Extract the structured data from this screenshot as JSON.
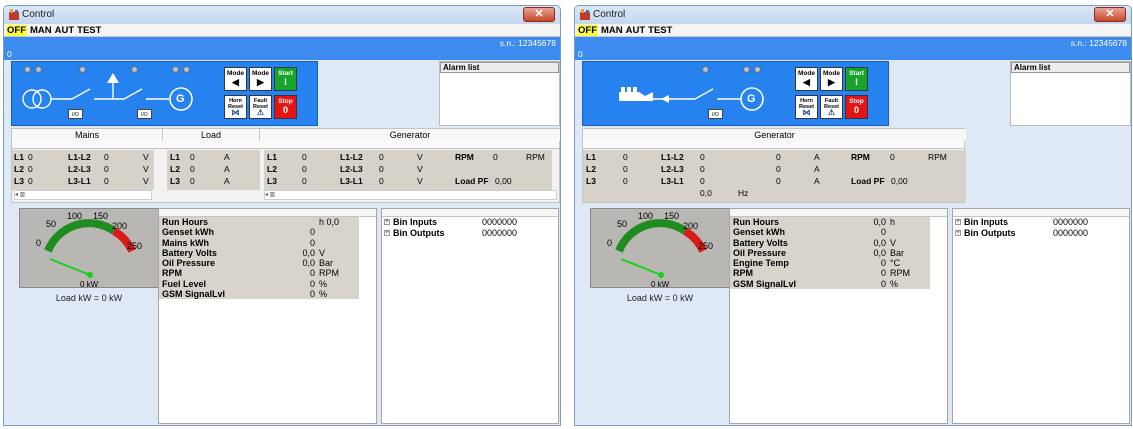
{
  "windows": [
    {
      "title": "Control",
      "close_glyph": "✕",
      "mode_bar": {
        "active": "OFF",
        "others": [
          "MAN",
          "AUT",
          "TEST"
        ]
      },
      "serial": "s.n.: 12345678",
      "bar_value": "0",
      "io_labels": [
        "I/O",
        "I/O"
      ],
      "gen_symbol": "G",
      "buttons": {
        "mode_left": {
          "label": "Mode",
          "glyph": "◀"
        },
        "mode_right": {
          "label": "Mode",
          "glyph": "▶"
        },
        "start": {
          "label": "Start",
          "glyph": "I"
        },
        "horn": {
          "label": "Horn Reset"
        },
        "fault": {
          "label": "Fault Reset"
        },
        "stop": {
          "label": "Stop",
          "glyph": "0"
        }
      },
      "alarm_list_header": "Alarm list",
      "sections": [
        "Mains",
        "Load",
        "Generator"
      ],
      "mains_rows": [
        [
          "L1",
          "0",
          "L1-L2",
          "0",
          "V"
        ],
        [
          "L2",
          "0",
          "L2-L3",
          "0",
          "V"
        ],
        [
          "L3",
          "0",
          "L3-L1",
          "0",
          "V"
        ]
      ],
      "load_rows": [
        [
          "L1",
          "0",
          "A"
        ],
        [
          "L2",
          "0",
          "A"
        ],
        [
          "L3",
          "0",
          "A"
        ]
      ],
      "gen_rows": [
        [
          "L1",
          "0",
          "L1-L2",
          "0",
          "V"
        ],
        [
          "L2",
          "0",
          "L2-L3",
          "0",
          "V"
        ],
        [
          "L3",
          "0",
          "L3-L1",
          "0",
          "V"
        ]
      ],
      "gen_extra": {
        "rpm_label": "RPM",
        "rpm_value": "0",
        "rpm_unit": "RPM",
        "loadpf_label": "Load PF",
        "loadpf_value": "0,00"
      },
      "gauge": {
        "ticks": [
          "0",
          "50",
          "100",
          "150",
          "200",
          "250"
        ],
        "readout": "0 kW",
        "caption": "Load kW = 0 kW",
        "value_fraction": 0
      },
      "values": [
        {
          "label": "Run Hours",
          "value": "0,0",
          "unit": "h"
        },
        {
          "label": "Genset kWh",
          "value": "0",
          "unit": ""
        },
        {
          "label": "Mains kWh",
          "value": "0",
          "unit": ""
        },
        {
          "label": "Battery Volts",
          "value": "0,0",
          "unit": "V"
        },
        {
          "label": "Oil Pressure",
          "value": "0,0",
          "unit": "Bar"
        },
        {
          "label": "RPM",
          "value": "0",
          "unit": "RPM"
        },
        {
          "label": "Fuel Level",
          "value": "0",
          "unit": "%"
        },
        {
          "label": "GSM SignalLvl",
          "value": "0",
          "unit": "%"
        }
      ],
      "bins": [
        {
          "label": "Bin Inputs",
          "value": "0000000"
        },
        {
          "label": "Bin Outputs",
          "value": "0000000"
        }
      ]
    },
    {
      "title": "Control",
      "close_glyph": "✕",
      "mode_bar": {
        "active": "OFF",
        "others": [
          "MAN",
          "AUT",
          "TEST"
        ]
      },
      "serial": "s.n.: 12345678",
      "bar_value": "0",
      "io_labels": [
        "I/O"
      ],
      "gen_symbol": "G",
      "buttons": {
        "mode_left": {
          "label": "Mode",
          "glyph": "◀"
        },
        "mode_right": {
          "label": "Mode",
          "glyph": "▶"
        },
        "start": {
          "label": "Start",
          "glyph": "I"
        },
        "horn": {
          "label": "Horn Reset"
        },
        "fault": {
          "label": "Fault Reset"
        },
        "stop": {
          "label": "Stop",
          "glyph": "0"
        }
      },
      "alarm_list_header": "Alarm list",
      "sections": [
        "Generator"
      ],
      "gen_rows": [
        [
          "L1",
          "0",
          "L1-L2",
          "0",
          "0",
          "A"
        ],
        [
          "L2",
          "0",
          "L2-L3",
          "0",
          "0",
          "A"
        ],
        [
          "L3",
          "0",
          "L3-L1",
          "0",
          "0",
          "A"
        ]
      ],
      "gen_extra": {
        "rpm_label": "RPM",
        "rpm_value": "0",
        "rpm_unit": "RPM",
        "loadpf_label": "Load PF",
        "loadpf_value": "0,00",
        "freq_value": "0,0",
        "freq_unit": "Hz"
      },
      "gauge": {
        "ticks": [
          "0",
          "50",
          "100",
          "150",
          "200",
          "250"
        ],
        "readout": "0 kW",
        "caption": "Load kW = 0 kW",
        "value_fraction": 0
      },
      "values": [
        {
          "label": "Run Hours",
          "value": "0,0",
          "unit": "h"
        },
        {
          "label": "Genset kWh",
          "value": "0",
          "unit": ""
        },
        {
          "label": "Battery Volts",
          "value": "0,0",
          "unit": "V"
        },
        {
          "label": "Oil Pressure",
          "value": "0,0",
          "unit": "Bar"
        },
        {
          "label": "Engine Temp",
          "value": "0",
          "unit": "°C"
        },
        {
          "label": "RPM",
          "value": "0",
          "unit": "RPM"
        },
        {
          "label": "GSM SignalLvl",
          "value": "0",
          "unit": "%"
        }
      ],
      "bins": [
        {
          "label": "Bin Inputs",
          "value": "0000000"
        },
        {
          "label": "Bin Outputs",
          "value": "0000000"
        }
      ]
    }
  ]
}
